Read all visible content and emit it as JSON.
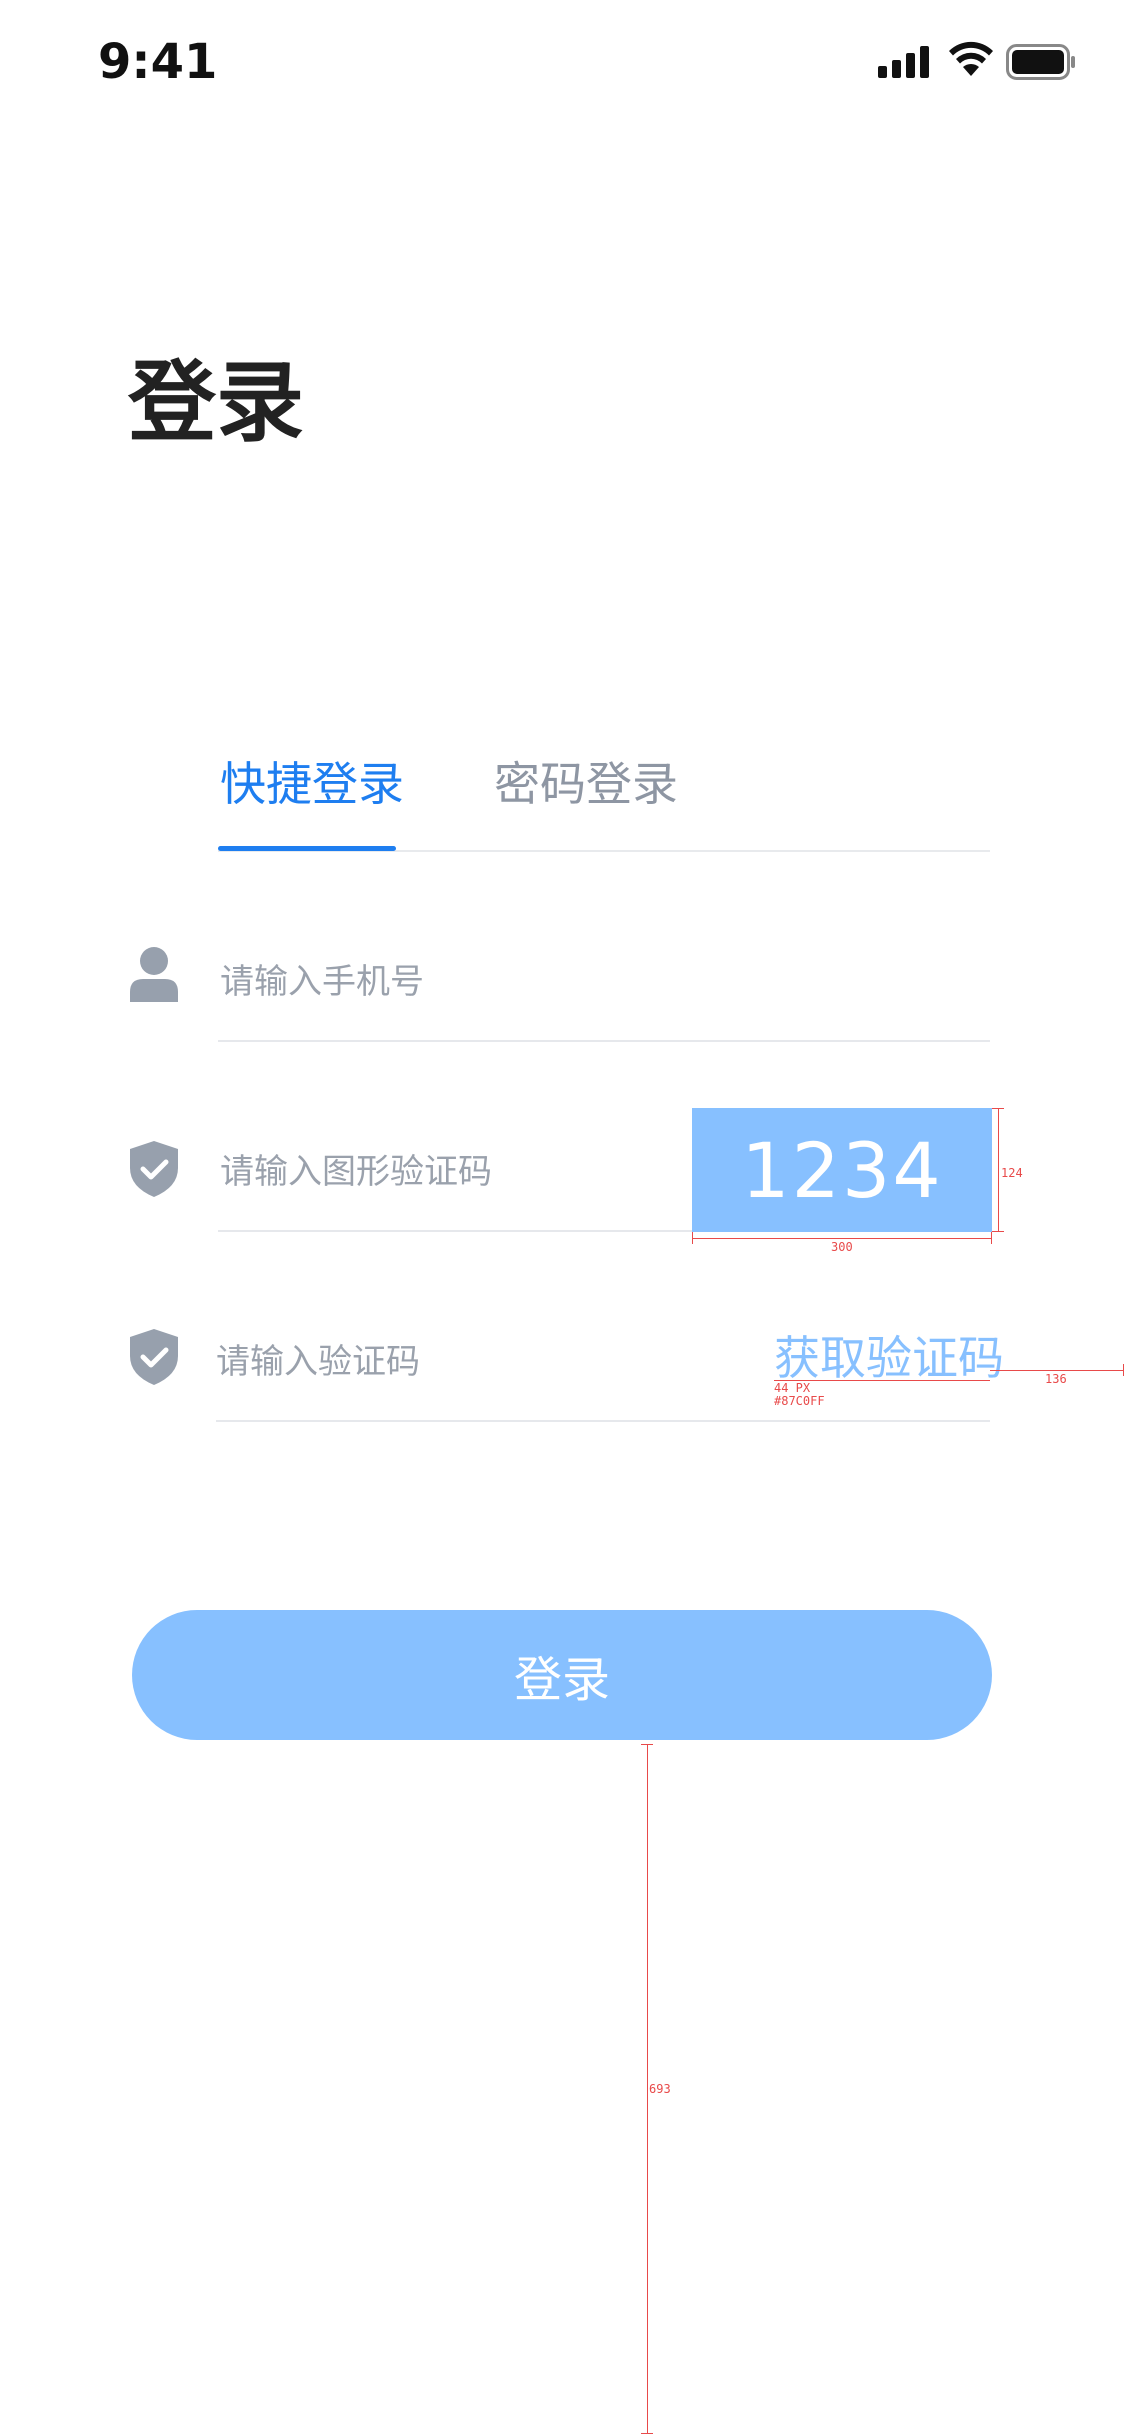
{
  "status_bar": {
    "time": "9:41"
  },
  "title": "登录",
  "tabs": [
    {
      "label": "快捷登录",
      "active": true
    },
    {
      "label": "密码登录",
      "active": false
    }
  ],
  "fields": {
    "phone": {
      "placeholder": "请输入手机号",
      "icon": "user-icon"
    },
    "image_code": {
      "placeholder": "请输入图形验证码",
      "icon": "shield-check-icon",
      "captcha": "1234"
    },
    "sms_code": {
      "placeholder": "请输入验证码",
      "icon": "shield-check-icon",
      "action": "获取验证码"
    }
  },
  "login_button": "登录",
  "annotations": {
    "captcha_height": "124",
    "captcha_width": "300",
    "font_size_note": "44 PX",
    "color_note": "#87C0FF",
    "right_margin": "136",
    "bottom_gap": "693"
  },
  "colors": {
    "accent": "#1E7EF0",
    "button": "#87C0FF",
    "placeholder": "#9AA1AC",
    "icon": "#97A0AD"
  }
}
